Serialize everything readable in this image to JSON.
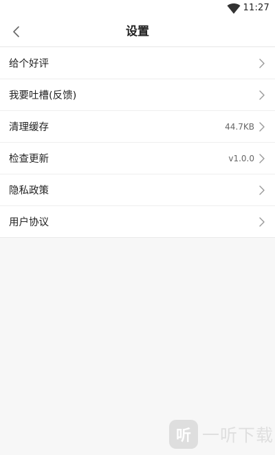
{
  "status_bar": {
    "time": "11:27",
    "icons": [
      "wifi-icon"
    ]
  },
  "nav": {
    "title": "设置",
    "back_icon": "chevron-left-icon"
  },
  "menu": {
    "items": [
      {
        "label": "给个好评",
        "value": ""
      },
      {
        "label": "我要吐槽(反馈)",
        "value": ""
      },
      {
        "label": "清理缓存",
        "value": "44.7KB"
      },
      {
        "label": "检查更新",
        "value": "v1.0.0"
      },
      {
        "label": "隐私政策",
        "value": ""
      },
      {
        "label": "用户协议",
        "value": ""
      }
    ],
    "item_icon": "chevron-right-icon"
  },
  "watermark": {
    "logo_char": "听",
    "text": "一听下载"
  },
  "colors": {
    "background": "#f7f7f7",
    "surface": "#ffffff",
    "text": "#222222",
    "secondary_text": "#666666",
    "chevron": "#999999"
  }
}
